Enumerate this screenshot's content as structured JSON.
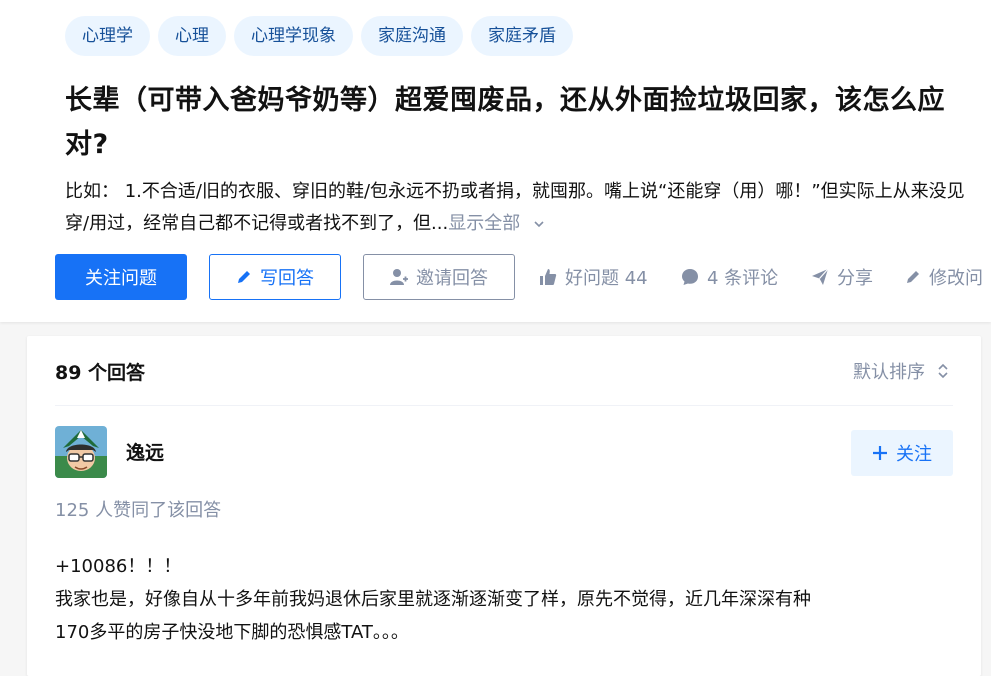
{
  "topics": [
    "心理学",
    "心理",
    "心理学现象",
    "家庭沟通",
    "家庭矛盾"
  ],
  "question": {
    "title": "长辈（可带入爸妈爷奶等）超爱囤废品，还从外面捡垃圾回家，该怎么应对?",
    "excerpt": "比如： 1.不合适/旧的衣服、穿旧的鞋/包永远不扔或者捐，就囤那。嘴上说“还能穿（用）哪！”但实际上从来没见穿/用过，经常自己都不记得或者找不到了，但...",
    "show_all": "显示全部"
  },
  "actions": {
    "follow_question": "关注问题",
    "write_answer": "写回答",
    "invite_answer": "邀请回答",
    "good_question": "好问题 44",
    "comments": "4 条评论",
    "share": "分享",
    "edit": "修改问"
  },
  "answers": {
    "count": "89 个回答",
    "sort": "默认排序"
  },
  "answer": {
    "author": "逸远",
    "follow": "关注",
    "votes": "125 人赞同了该回答",
    "paragraphs": [
      "+10086！！！",
      "我家也是，好像自从十多年前我妈退休后家里就逐渐逐渐变了样，原先不觉得，近几年深深有种",
      "170多平的房子快没地下脚的恐惧感TAT。。。"
    ]
  },
  "colors": {
    "accent": "#1772f6",
    "muted": "#8590a6",
    "tag_bg": "#ebf5ff",
    "tag_text": "#175199"
  }
}
